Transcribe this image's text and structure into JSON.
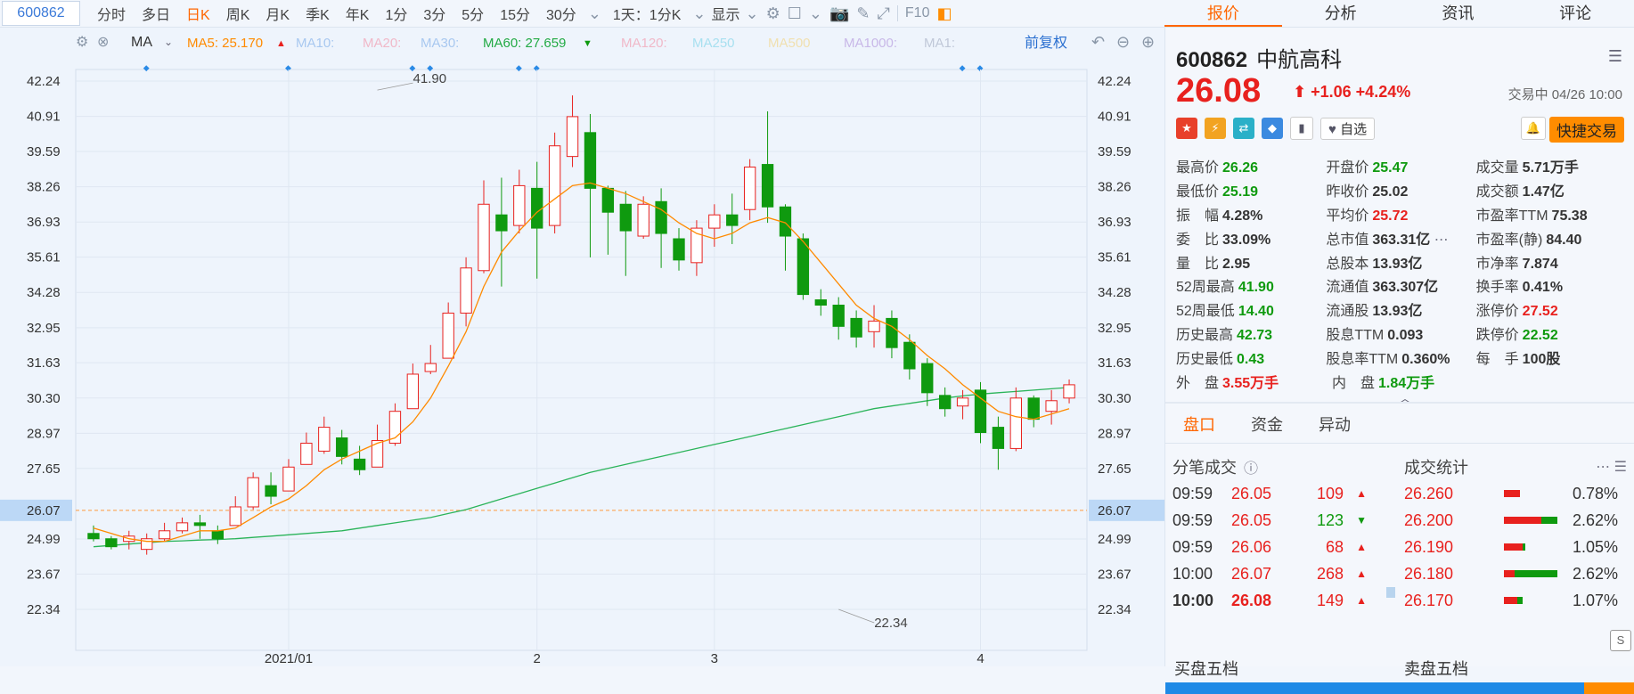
{
  "toolbar": {
    "code": "600862",
    "tabs": [
      "分时",
      "多日",
      "日K",
      "周K",
      "月K",
      "季K",
      "年K",
      "1分",
      "3分",
      "5分",
      "15分",
      "30分"
    ],
    "active_tab": "日K",
    "period_select": "1天：1分K",
    "display_label": "显示"
  },
  "right_tabs": [
    "报价",
    "分析",
    "资讯",
    "评论"
  ],
  "ma_bar": {
    "label": "MA",
    "items": [
      {
        "text": "MA5: 25.170",
        "color": "#ff8a00",
        "arrow": "▲",
        "arrow_color": "#e8211e"
      },
      {
        "text": "MA10:",
        "color": "#a8c8f0"
      },
      {
        "text": "MA20:",
        "color": "#f0b8c8"
      },
      {
        "text": "MA30:",
        "color": "#a8c8f0"
      },
      {
        "text": "MA60: 27.659",
        "color": "#22aa44",
        "arrow": "▼",
        "arrow_color": "#0f9a0f"
      },
      {
        "text": "MA120:",
        "color": "#f0b8c8"
      },
      {
        "text": "MA250",
        "color": "#a8e0f0"
      },
      {
        "text": "MA500",
        "color": "#f0e0b0"
      },
      {
        "text": "MA1000:",
        "color": "#c8b8e8"
      },
      {
        "text": "MA1:",
        "color": "#c0c8d8"
      }
    ],
    "fq_label": "前复权"
  },
  "chart_data": {
    "type": "candlestick",
    "y_ticks": [
      42.24,
      40.91,
      39.59,
      38.26,
      36.93,
      35.61,
      34.28,
      32.95,
      31.63,
      30.3,
      28.97,
      27.65,
      26.07,
      24.99,
      23.67,
      22.34
    ],
    "ylim": [
      22.34,
      42.24
    ],
    "x_labels": [
      {
        "label": "2021/01",
        "index": 11
      },
      {
        "label": "2",
        "index": 25
      },
      {
        "label": "3",
        "index": 35
      },
      {
        "label": "4",
        "index": 50
      }
    ],
    "current_price": 26.07,
    "annotations": [
      {
        "text": "41.90",
        "index": 16,
        "value": 41.9
      },
      {
        "text": "22.34",
        "index": 42,
        "value": 22.34
      }
    ],
    "candles": [
      [
        25.2,
        25.3,
        25.0,
        24.9,
        25.5
      ],
      [
        25.0,
        24.9,
        24.7,
        24.6,
        25.1
      ],
      [
        24.9,
        24.6,
        25.1,
        24.6,
        25.3
      ],
      [
        24.6,
        24.4,
        25.0,
        24.4,
        25.2
      ],
      [
        25.0,
        25.1,
        25.3,
        24.9,
        25.6
      ],
      [
        25.3,
        25.4,
        25.6,
        25.2,
        25.8
      ],
      [
        25.6,
        25.3,
        25.5,
        25.0,
        25.9
      ],
      [
        25.3,
        25.2,
        25.0,
        24.8,
        25.5
      ],
      [
        25.5,
        25.7,
        26.2,
        25.5,
        26.6
      ],
      [
        26.2,
        26.5,
        27.3,
        26.1,
        27.5
      ],
      [
        27.0,
        27.2,
        26.6,
        26.3,
        27.5
      ],
      [
        26.8,
        27.2,
        27.7,
        26.9,
        28.0
      ],
      [
        27.8,
        28.1,
        28.6,
        27.8,
        29.0
      ],
      [
        28.3,
        28.5,
        29.2,
        28.2,
        29.6
      ],
      [
        28.8,
        28.4,
        28.1,
        27.8,
        29.1
      ],
      [
        28.0,
        28.2,
        27.6,
        27.4,
        28.5
      ],
      [
        27.7,
        28.0,
        28.7,
        27.7,
        29.3
      ],
      [
        28.6,
        29.0,
        29.8,
        28.5,
        30.1
      ],
      [
        29.9,
        30.4,
        31.2,
        29.9,
        31.6
      ],
      [
        31.3,
        31.8,
        31.6,
        31.2,
        32.3
      ],
      [
        31.8,
        32.5,
        33.5,
        31.8,
        33.9
      ],
      [
        33.5,
        34.0,
        35.2,
        33.0,
        35.6
      ],
      [
        35.1,
        36.5,
        37.6,
        35.0,
        38.5
      ],
      [
        37.2,
        37.6,
        36.6,
        34.5,
        38.6
      ],
      [
        36.8,
        37.6,
        38.3,
        36.5,
        38.9
      ],
      [
        38.2,
        38.4,
        36.7,
        34.8,
        39.2
      ],
      [
        36.8,
        37.5,
        39.8,
        36.5,
        40.3
      ],
      [
        39.4,
        39.5,
        40.9,
        39.0,
        41.7
      ],
      [
        40.3,
        40.5,
        38.2,
        35.6,
        41.0
      ],
      [
        38.2,
        37.8,
        37.3,
        35.7,
        38.3
      ],
      [
        37.6,
        37.4,
        36.6,
        34.9,
        38.1
      ],
      [
        36.4,
        36.7,
        37.6,
        36.3,
        37.9
      ],
      [
        37.7,
        37.8,
        36.5,
        35.2,
        38.2
      ],
      [
        36.3,
        36.1,
        35.5,
        35.1,
        36.7
      ],
      [
        35.4,
        35.5,
        36.7,
        34.9,
        37.0
      ],
      [
        36.7,
        36.8,
        37.2,
        36.0,
        37.6
      ],
      [
        37.2,
        37.3,
        36.8,
        36.1,
        38.0
      ],
      [
        37.4,
        37.8,
        39.0,
        37.0,
        39.3
      ],
      [
        39.1,
        38.3,
        37.5,
        36.9,
        41.1
      ],
      [
        37.5,
        37.1,
        36.4,
        35.1,
        37.6
      ],
      [
        36.3,
        36.0,
        34.2,
        34.0,
        36.5
      ],
      [
        34.0,
        33.6,
        33.8,
        33.4,
        34.4
      ],
      [
        33.8,
        33.5,
        33.0,
        32.5,
        34.1
      ],
      [
        33.3,
        32.8,
        32.6,
        32.2,
        33.6
      ],
      [
        32.8,
        32.5,
        33.2,
        32.2,
        33.8
      ],
      [
        33.3,
        32.8,
        32.2,
        31.8,
        33.6
      ],
      [
        32.4,
        32.0,
        31.4,
        31.0,
        32.7
      ],
      [
        31.6,
        31.1,
        30.5,
        30.0,
        31.8
      ],
      [
        30.4,
        30.1,
        29.9,
        29.6,
        30.7
      ],
      [
        30.0,
        29.7,
        30.3,
        29.5,
        30.6
      ],
      [
        30.6,
        30.2,
        29.0,
        28.6,
        30.9
      ],
      [
        29.2,
        28.8,
        28.4,
        27.6,
        29.6
      ],
      [
        28.4,
        28.6,
        30.3,
        28.3,
        30.7
      ],
      [
        30.3,
        30.0,
        29.5,
        29.2,
        30.4
      ],
      [
        29.8,
        29.6,
        30.2,
        29.3,
        30.6
      ],
      [
        30.3,
        30.2,
        30.8,
        30.1,
        31.0
      ]
    ],
    "ma5": [
      25.4,
      25.2,
      25.0,
      24.9,
      24.9,
      25.1,
      25.3,
      25.3,
      25.4,
      25.8,
      26.2,
      26.5,
      27.0,
      27.6,
      28.0,
      28.3,
      28.6,
      28.8,
      29.4,
      30.3,
      31.5,
      32.8,
      34.5,
      35.8,
      36.6,
      37.3,
      37.8,
      38.3,
      38.4,
      38.2,
      38.0,
      37.7,
      37.4,
      36.9,
      36.5,
      36.3,
      36.5,
      36.9,
      37.1,
      36.9,
      36.2,
      35.4,
      34.6,
      33.8,
      33.3,
      33.0,
      32.5,
      31.9,
      31.4,
      30.8,
      30.3,
      29.8,
      29.6,
      29.5,
      29.7,
      29.9
    ],
    "ma60": [
      24.7,
      24.75,
      24.8,
      24.85,
      24.9,
      24.92,
      24.95,
      24.97,
      25.0,
      25.05,
      25.1,
      25.15,
      25.2,
      25.25,
      25.3,
      25.4,
      25.5,
      25.6,
      25.7,
      25.8,
      25.95,
      26.1,
      26.3,
      26.5,
      26.7,
      26.9,
      27.1,
      27.3,
      27.5,
      27.65,
      27.8,
      27.95,
      28.1,
      28.25,
      28.4,
      28.55,
      28.7,
      28.85,
      29.0,
      29.15,
      29.3,
      29.45,
      29.6,
      29.75,
      29.9,
      30.0,
      30.1,
      30.2,
      30.3,
      30.38,
      30.45,
      30.5,
      30.55,
      30.6,
      30.65,
      30.7
    ]
  },
  "quote": {
    "code": "600862",
    "name": "中航高科",
    "price": "26.08",
    "arrow": "⬆",
    "change": "+1.06",
    "change_pct": "+4.24%",
    "trade_info": "交易中 04/26 10:00",
    "zixuan_label": "自选",
    "quick_trade": "快捷交易",
    "stats": [
      [
        {
          "label": "最高价",
          "value": "26.26",
          "color": "green"
        },
        {
          "label": "开盘价",
          "value": "25.47",
          "color": "green"
        },
        {
          "label": "成交量",
          "value": "5.71万手",
          "color": "dark"
        }
      ],
      [
        {
          "label": "最低价",
          "value": "25.19",
          "color": "green"
        },
        {
          "label": "昨收价",
          "value": "25.02",
          "color": "dark"
        },
        {
          "label": "成交额",
          "value": "1.47亿",
          "color": "dark"
        }
      ],
      [
        {
          "label": "振　幅",
          "value": "4.28%",
          "color": "dark"
        },
        {
          "label": "平均价",
          "value": "25.72",
          "color": "red"
        },
        {
          "label": "市盈率TTM",
          "value": "75.38",
          "color": "dark"
        }
      ],
      [
        {
          "label": "委　比",
          "value": "33.09%",
          "color": "dark"
        },
        {
          "label": "总市值",
          "value": "363.31亿",
          "color": "dark"
        },
        {
          "label": "市盈率(静)",
          "value": "84.40",
          "color": "dark"
        }
      ],
      [
        {
          "label": "量　比",
          "value": "2.95",
          "color": "dark"
        },
        {
          "label": "总股本",
          "value": "13.93亿",
          "color": "dark"
        },
        {
          "label": "市净率",
          "value": "7.874",
          "color": "dark"
        }
      ],
      [
        {
          "label": "52周最高",
          "value": "41.90",
          "color": "green"
        },
        {
          "label": "流通值",
          "value": "363.307亿",
          "color": "dark"
        },
        {
          "label": "换手率",
          "value": "0.41%",
          "color": "dark"
        }
      ],
      [
        {
          "label": "52周最低",
          "value": "14.40",
          "color": "green"
        },
        {
          "label": "流通股",
          "value": "13.93亿",
          "color": "dark"
        },
        {
          "label": "涨停价",
          "value": "27.52",
          "color": "red"
        }
      ],
      [
        {
          "label": "历史最高",
          "value": "42.73",
          "color": "green"
        },
        {
          "label": "股息TTM",
          "value": "0.093",
          "color": "dark"
        },
        {
          "label": "跌停价",
          "value": "22.52",
          "color": "green"
        }
      ],
      [
        {
          "label": "历史最低",
          "value": "0.43",
          "color": "green"
        },
        {
          "label": "股息率TTM",
          "value": "0.360%",
          "color": "dark"
        },
        {
          "label": "每　手",
          "value": "100股",
          "color": "dark"
        }
      ],
      [
        {
          "label": "外　盘",
          "value": "3.55万手",
          "color": "red"
        },
        {
          "label": "内　盘",
          "value": "1.84万手",
          "color": "green"
        }
      ]
    ]
  },
  "sub_tabs": [
    "盘口",
    "资金",
    "异动"
  ],
  "ticks_title": "分笔成交",
  "ticks": [
    {
      "time": "09:59",
      "price": "26.05",
      "vol": "109",
      "dir": "up"
    },
    {
      "time": "09:59",
      "price": "26.05",
      "vol": "123",
      "dir": "down"
    },
    {
      "time": "09:59",
      "price": "26.06",
      "vol": "68",
      "dir": "up"
    },
    {
      "time": "10:00",
      "price": "26.07",
      "vol": "268",
      "dir": "up"
    },
    {
      "time": "10:00",
      "price": "26.08",
      "vol": "149",
      "dir": "up"
    }
  ],
  "stat_title": "成交统计",
  "stat_rows": [
    {
      "price": "26.260",
      "pct": "0.78%",
      "red": 0.3,
      "green": 0.0
    },
    {
      "price": "26.200",
      "pct": "2.62%",
      "red": 0.7,
      "green": 0.3
    },
    {
      "price": "26.190",
      "pct": "1.05%",
      "red": 0.35,
      "green": 0.05
    },
    {
      "price": "26.180",
      "pct": "2.62%",
      "red": 0.2,
      "green": 0.8
    },
    {
      "price": "26.170",
      "pct": "1.07%",
      "red": 0.25,
      "green": 0.1
    }
  ],
  "buy5": "买盘五档",
  "sell5": "卖盘五档"
}
